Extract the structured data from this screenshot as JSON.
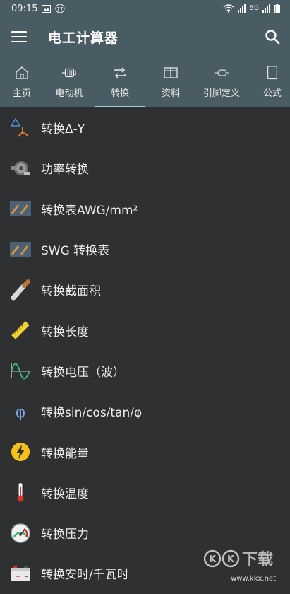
{
  "status": {
    "time": "09:15",
    "network": "5G"
  },
  "app": {
    "title": "电工计算器"
  },
  "tabs": [
    {
      "label": "主页",
      "icon": "home-icon"
    },
    {
      "label": "电动机",
      "icon": "motor-icon"
    },
    {
      "label": "转换",
      "icon": "convert-icon",
      "active": true
    },
    {
      "label": "资料",
      "icon": "book-icon"
    },
    {
      "label": "引脚定义",
      "icon": "pin-icon"
    },
    {
      "label": "公式",
      "icon": "formula-icon"
    }
  ],
  "items": [
    {
      "label": "转换Δ-Y",
      "icon": "delta-y-icon"
    },
    {
      "label": "功率转换",
      "icon": "motor-photo-icon"
    },
    {
      "label": "转换表AWG/mm²",
      "icon": "wire-gauge-icon"
    },
    {
      "label": "SWG 转换表",
      "icon": "wire-gauge-icon"
    },
    {
      "label": "转换截面积",
      "icon": "cable-section-icon"
    },
    {
      "label": "转换长度",
      "icon": "ruler-icon"
    },
    {
      "label": "转换电压（波）",
      "icon": "sine-wave-icon"
    },
    {
      "label": "转换sin/cos/tan/φ",
      "icon": "phi-icon"
    },
    {
      "label": "转换能量",
      "icon": "lightning-icon"
    },
    {
      "label": "转换温度",
      "icon": "thermometer-icon"
    },
    {
      "label": "转换压力",
      "icon": "gauge-icon"
    },
    {
      "label": "转换安时/千瓦时",
      "icon": "battery-icon"
    }
  ],
  "watermark": {
    "brand": "KK下载",
    "url": "www.kkx.net"
  },
  "colors": {
    "bar": "#4a5c63",
    "background": "#2f3031",
    "tab_indicator": "#9fd0d8"
  }
}
